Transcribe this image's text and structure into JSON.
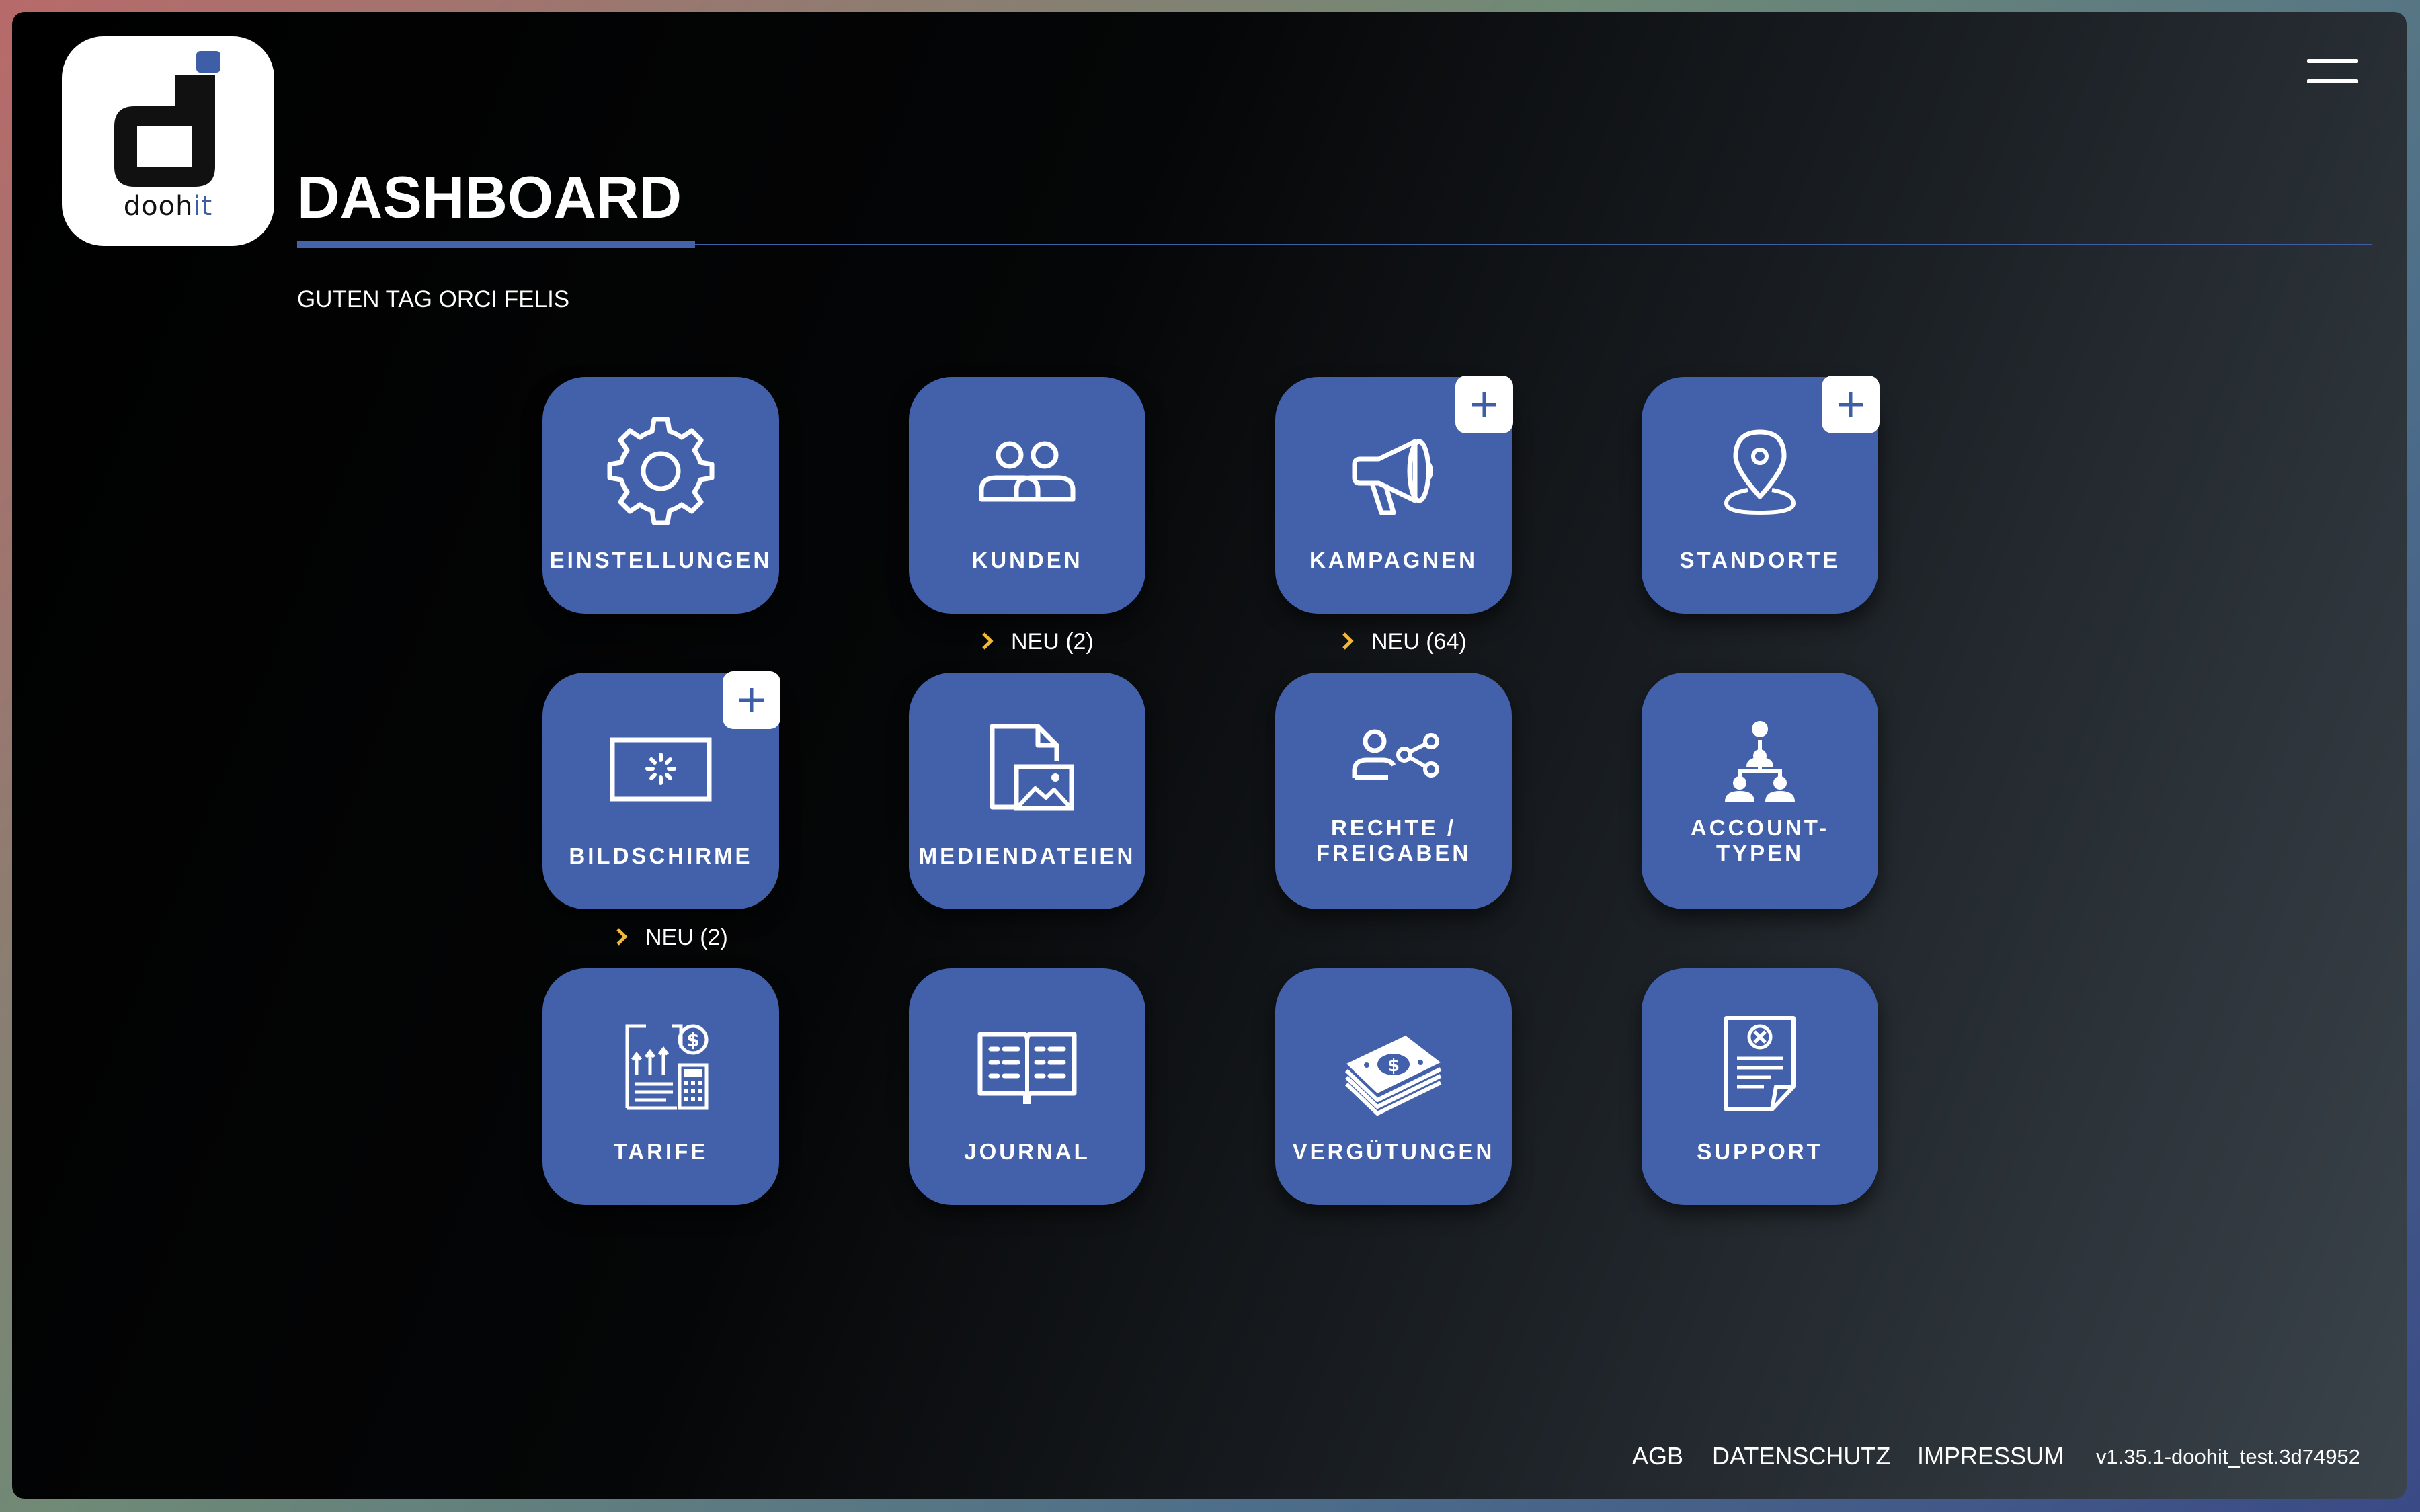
{
  "header": {
    "logo_text": "dooh",
    "logo_text_accent": "it",
    "title": "DASHBOARD",
    "greeting": "GUTEN TAG ORCI FELIS"
  },
  "tiles": [
    {
      "label": "EINSTELLUNGEN",
      "icon": "gear-icon"
    },
    {
      "label": "KUNDEN",
      "icon": "users-icon",
      "new_label": "NEU (2)"
    },
    {
      "label": "KAMPAGNEN",
      "icon": "megaphone-icon",
      "new_label": "NEU (64)",
      "plus": true
    },
    {
      "label": "STANDORTE",
      "icon": "location-pin-icon",
      "plus": true
    },
    {
      "label": "BILDSCHIRME",
      "icon": "screen-icon",
      "new_label": "NEU (2)",
      "plus": true
    },
    {
      "label": "MEDIENDATEIEN",
      "icon": "media-file-icon"
    },
    {
      "label": "RECHTE / FREIGABEN",
      "line1": "RECHTE /",
      "line2": "FREIGABEN",
      "icon": "user-share-icon"
    },
    {
      "label": "ACCOUNT-TYPEN",
      "line1": "ACCOUNT-",
      "line2": "TYPEN",
      "icon": "hierarchy-icon"
    },
    {
      "label": "TARIFE",
      "icon": "tariff-document-icon"
    },
    {
      "label": "JOURNAL",
      "icon": "open-book-icon"
    },
    {
      "label": "VERGÜTUNGEN",
      "icon": "money-stack-icon"
    },
    {
      "label": "SUPPORT",
      "icon": "support-document-icon"
    }
  ],
  "footer": {
    "agb": "AGB",
    "datenschutz": "DATENSCHUTZ",
    "impressum": "IMPRESSUM",
    "version": "v1.35.1-doohit_test.3d74952"
  },
  "colors": {
    "tile": "#4361aa",
    "accent": "#3f5ea8",
    "chevron": "#f2b83a",
    "background": "#000000"
  }
}
